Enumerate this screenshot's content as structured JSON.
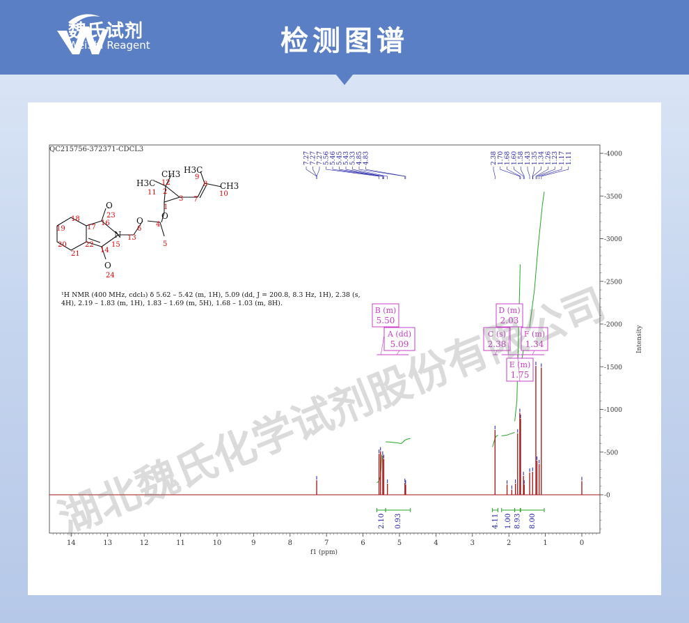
{
  "header": {
    "title": "检测图谱",
    "logo_cn": "魏氏试剂",
    "logo_en": "WeiShi Reagent"
  },
  "watermark": "湖北魏氏化学试剂股份有限公司",
  "colors": {
    "banner": "#5b7fc5",
    "spectrum": "#a01010",
    "peak_label": "#1a1aa6",
    "integral": "#23a523",
    "multiplet": "#c83cc8"
  },
  "chart_data": {
    "type": "line",
    "sample_id": "QC215756-372371-CDCL3",
    "xlabel": "f1 (ppm)",
    "ylabel": "Intensity",
    "x_reversed": true,
    "xlim": [
      14.5,
      -0.5
    ],
    "ylim": [
      -450,
      4080
    ],
    "x_ticks": [
      "14",
      "13",
      "12",
      "11",
      "10",
      "9",
      "8",
      "7",
      "6",
      "5",
      "4",
      "3",
      "2",
      "1",
      "0"
    ],
    "y_ticks": [
      "-0",
      "-500",
      "-1000",
      "-1500",
      "-2000",
      "-2500",
      "-3000",
      "-3500",
      "-4000"
    ],
    "nmr_text_line1": "¹H NMR (400 MHz, cdcl₃) δ 5.62 – 5.42 (m, 1H), 5.09 (dd, J = 200.8, 8.3 Hz, 1H), 2.38 (s,",
    "nmr_text_line2": "4H), 2.19 – 1.83 (m, 1H), 1.83 – 1.69 (m, 5H), 1.68 – 1.03 (m, 8H).",
    "peak_labels_left": [
      "7.27",
      "7.27",
      "7.27",
      "5.56",
      "5.46",
      "5.45",
      "5.43",
      "5.33",
      "4.85",
      "4.83"
    ],
    "peak_labels_right": [
      "2.38",
      "1.70",
      "1.68",
      "1.60",
      "1.58",
      "1.43",
      "1.35",
      "1.34",
      "1.26",
      "1.23",
      "1.17",
      "1.11"
    ],
    "peaks": [
      {
        "ppm": 7.27,
        "intensity": 170
      },
      {
        "ppm": 5.56,
        "intensity": 480
      },
      {
        "ppm": 5.52,
        "intensity": 510
      },
      {
        "ppm": 5.46,
        "intensity": 460
      },
      {
        "ppm": 5.43,
        "intensity": 420
      },
      {
        "ppm": 5.33,
        "intensity": 130
      },
      {
        "ppm": 4.85,
        "intensity": 140
      },
      {
        "ppm": 4.83,
        "intensity": 120
      },
      {
        "ppm": 2.38,
        "intensity": 760
      },
      {
        "ppm": 2.05,
        "intensity": 120
      },
      {
        "ppm": 1.92,
        "intensity": 60
      },
      {
        "ppm": 1.82,
        "intensity": 130
      },
      {
        "ppm": 1.76,
        "intensity": 720
      },
      {
        "ppm": 1.7,
        "intensity": 960
      },
      {
        "ppm": 1.68,
        "intensity": 890
      },
      {
        "ppm": 1.6,
        "intensity": 220
      },
      {
        "ppm": 1.58,
        "intensity": 120
      },
      {
        "ppm": 1.43,
        "intensity": 260
      },
      {
        "ppm": 1.35,
        "intensity": 270
      },
      {
        "ppm": 1.26,
        "intensity": 1510
      },
      {
        "ppm": 1.23,
        "intensity": 400
      },
      {
        "ppm": 1.17,
        "intensity": 360
      },
      {
        "ppm": 1.11,
        "intensity": 1490
      },
      {
        "ppm": 0.0,
        "intensity": 160
      }
    ],
    "integrals": [
      {
        "from": 5.62,
        "to": 5.38,
        "value": "2.10"
      },
      {
        "from": 5.38,
        "to": 4.7,
        "value": "0.93"
      },
      {
        "from": 2.45,
        "to": 2.3,
        "value": "4.11"
      },
      {
        "from": 2.2,
        "to": 1.84,
        "value": "1.00"
      },
      {
        "from": 1.84,
        "to": 1.69,
        "value": "8.93"
      },
      {
        "from": 1.68,
        "to": 1.03,
        "value": "8.00"
      }
    ],
    "multiplets": [
      {
        "letter": "B (m)",
        "value": "5.50"
      },
      {
        "letter": "A (dd)",
        "value": "5.09"
      },
      {
        "letter": "C (s)",
        "value": "2.38"
      },
      {
        "letter": "D (m)",
        "value": "2.03"
      },
      {
        "letter": "F (m)",
        "value": "1.34"
      },
      {
        "letter": "E (m)",
        "value": "1.75"
      }
    ],
    "structure_atoms": [
      "H3C",
      "CH3",
      "11",
      "12",
      "2",
      "H3C",
      "9",
      "8",
      "CH3",
      "10",
      "3",
      "7",
      "1",
      "O",
      "23",
      "16",
      "18",
      "19",
      "17",
      "N",
      "O",
      "6",
      "4",
      "13",
      "15",
      "O",
      "5",
      "20",
      "22",
      "14",
      "21",
      "O",
      "24"
    ]
  }
}
